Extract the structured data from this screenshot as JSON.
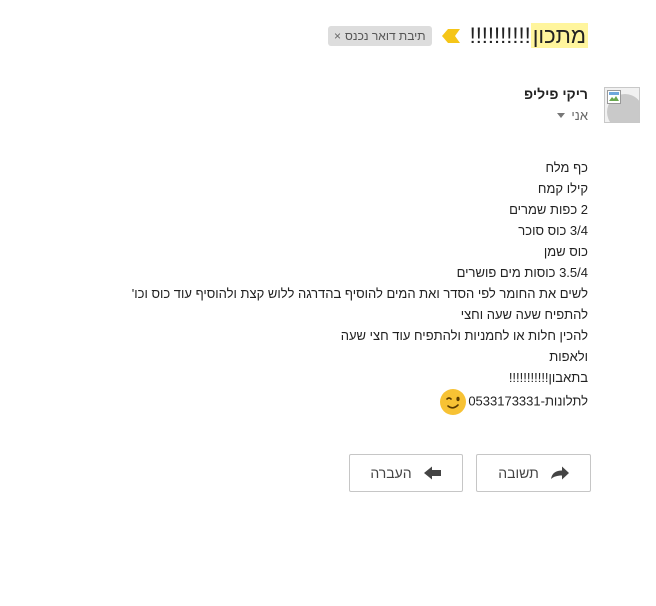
{
  "email": {
    "subject_highlight": "מתכון",
    "subject_rest": "!!!!!!!!!!",
    "label": "תיבת דואר נכנס",
    "label_remove": "×",
    "sender_name": "ריקי פיליפ",
    "recipient": "אני",
    "body_lines": [
      "כף מלח",
      "קילו קמח",
      "2 כפות שמרים",
      "3/4 כוס סוכר",
      "כוס שמן",
      "3.5/4 כוסות מים פושרים",
      "לשים את החומר לפי הסדר ואת המים להוסיף בהדרגה ללוש קצת ולהוסיף עוד כוס וכו'",
      "להתפיח שעה שעה וחצי",
      "להכין חלות או לחמניות ולהתפיח עוד חצי שעה",
      "ולאפות",
      "בתאבון!!!!!!!!!!!",
      "לתלונות-0533173331"
    ]
  },
  "actions": {
    "reply": "תשובה",
    "forward": "העברה"
  },
  "icons": {
    "importance": "importance-marker-icon",
    "reply": "reply-arrow-icon",
    "forward": "forward-arrow-icon",
    "emoji": "wink-emoji-icon",
    "caret": "caret-down-icon"
  },
  "colors": {
    "highlight": "#fff59d",
    "importance": "#f5c518",
    "chip_bg": "#dddddd",
    "emoji": "#f7c234"
  }
}
